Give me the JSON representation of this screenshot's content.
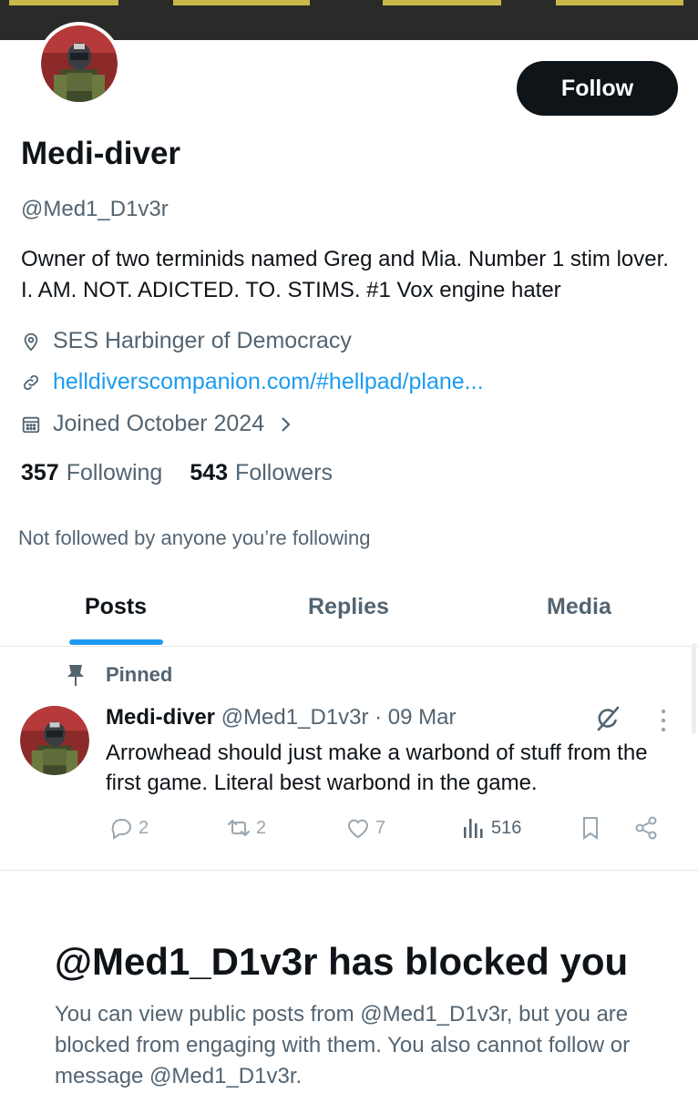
{
  "profile": {
    "display_name": "Medi-diver",
    "handle": "@Med1_D1v3r",
    "bio": "Owner of two terminids named Greg and Mia. Number 1 stim lover. I. AM. NOT. ADICTED. TO. STIMS. #1 Vox engine hater",
    "location": "SES Harbinger of Democracy",
    "website": "helldiverscompanion.com/#hellpad/plane...",
    "joined": "Joined October 2024",
    "following_count": "357",
    "following_label": "Following",
    "followers_count": "543",
    "followers_label": "Followers",
    "not_followed_note": "Not followed by anyone you’re following",
    "follow_button_label": "Follow"
  },
  "tabs": [
    {
      "label": "Posts",
      "active": true
    },
    {
      "label": "Replies",
      "active": false
    },
    {
      "label": "Media",
      "active": false
    }
  ],
  "pinned_post": {
    "pinned_label": "Pinned",
    "author_name": "Medi-diver",
    "author_handle_date": "@Med1_D1v3r · 09 Mar",
    "text": "Arrowhead should just make a warbond of stuff from the first game. Literal best warbond in the game.",
    "replies": "2",
    "reposts": "2",
    "likes": "7",
    "views": "516"
  },
  "blocked_notice": {
    "title": "@Med1_D1v3r has blocked you",
    "description": "You can view public posts from @Med1_D1v3r, but you are blocked from engaging with them. You also cannot follow or message @Med1_D1v3r."
  },
  "colors": {
    "accent": "#1d9bf0",
    "text_primary": "#0f1419",
    "text_secondary": "#536471",
    "button_dark": "#0f1419"
  },
  "icons": [
    "location-icon",
    "link-icon",
    "calendar-icon",
    "chevron-right-icon",
    "pin-icon",
    "grok-icon",
    "more-icon",
    "reply-icon",
    "repost-icon",
    "like-icon",
    "views-icon",
    "bookmark-icon",
    "share-icon"
  ]
}
